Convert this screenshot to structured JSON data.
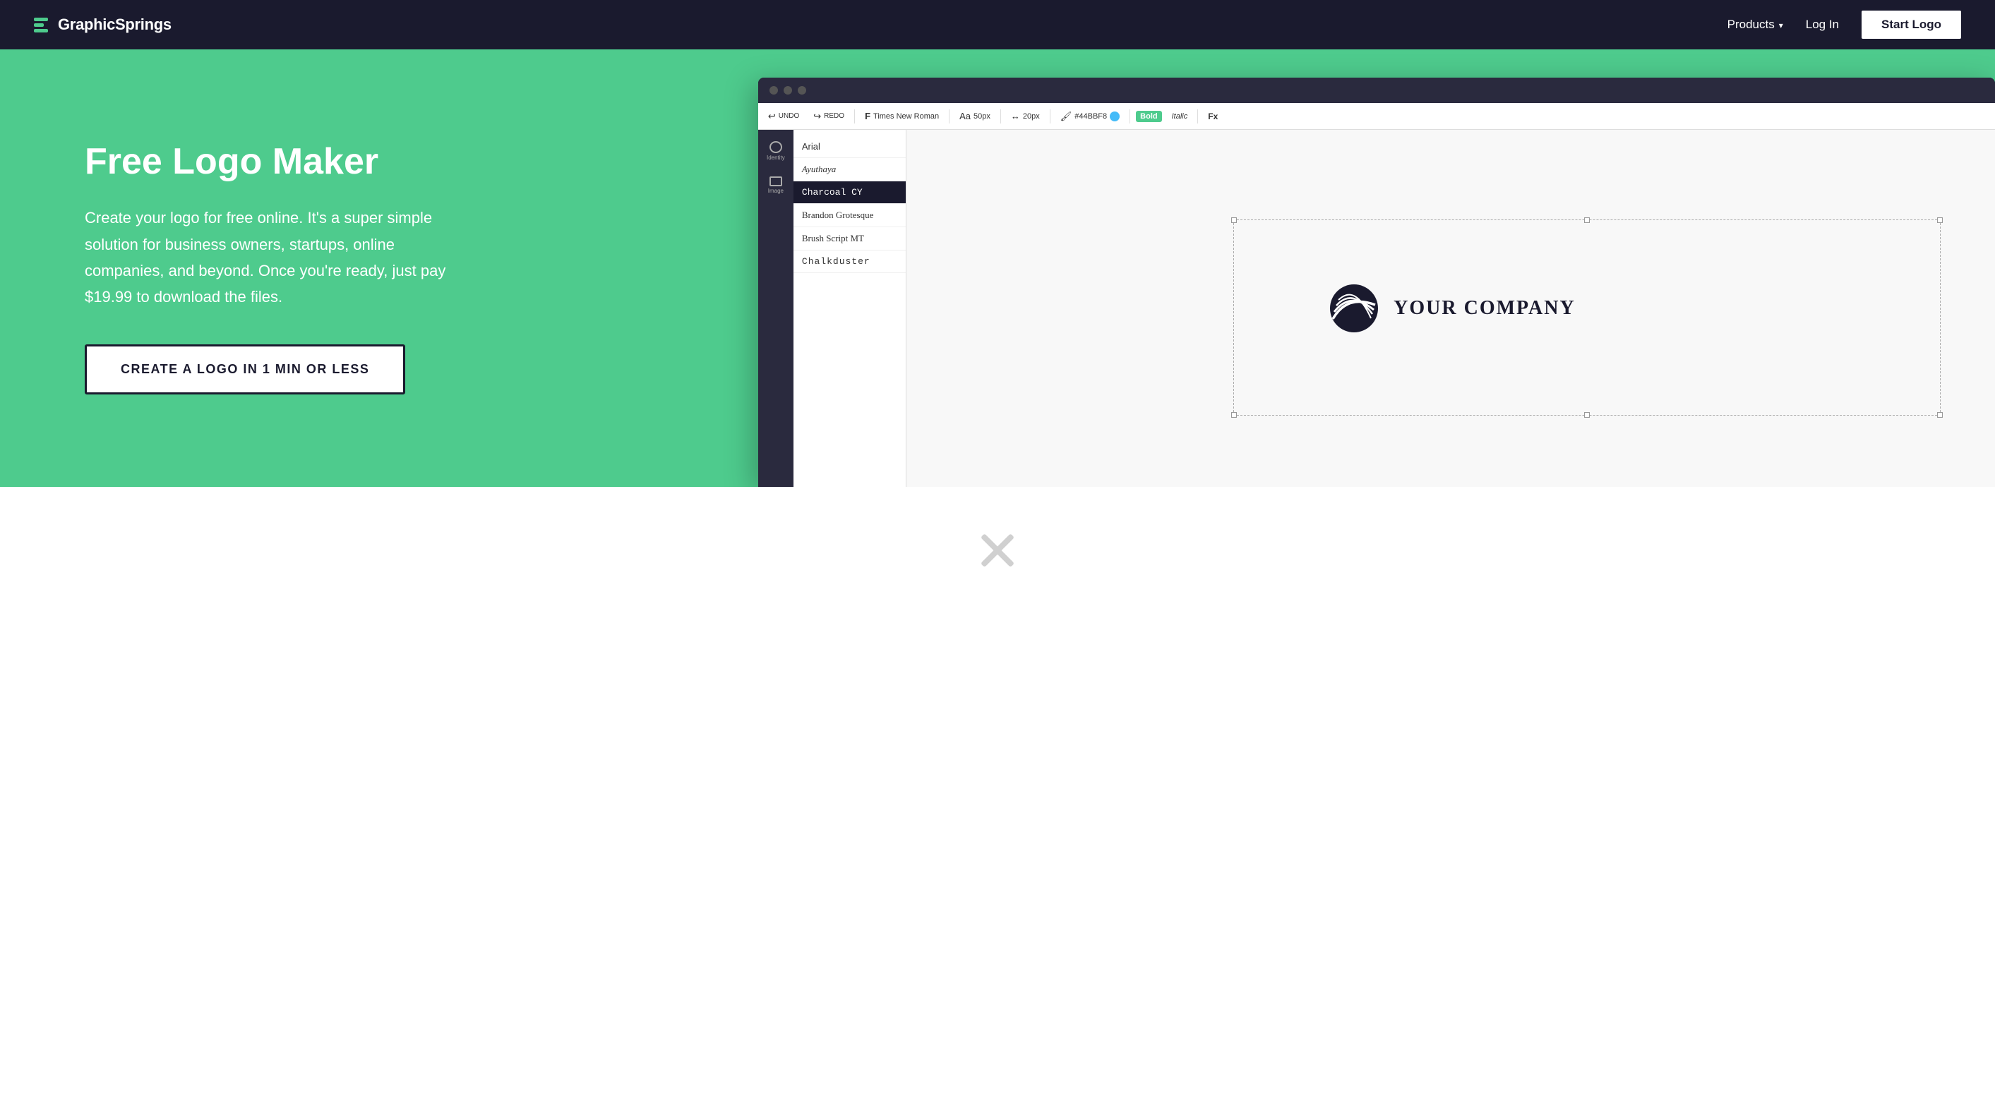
{
  "navbar": {
    "brand_name": "GraphicSprings",
    "products_label": "Products",
    "login_label": "Log In",
    "start_logo_label": "Start Logo"
  },
  "hero": {
    "title": "Free Logo Maker",
    "description": "Create your logo for free online. It's a super simple solution for business owners, startups, online companies, and beyond. Once you're ready, just pay $19.99 to download the files.",
    "cta_label": "CREATE A LOGO IN 1 MIN OR LESS"
  },
  "mockup": {
    "toolbar": {
      "font_label": "Times New Roman",
      "size_label": "50px",
      "spacing_label": "20px",
      "color_hex": "#44BBF8",
      "style_bold": "Bold",
      "style_italic": "Italic",
      "fx_label": "Fx"
    },
    "font_panel": {
      "fonts": [
        {
          "name": "Arial",
          "selected": false
        },
        {
          "name": "Ayuthaya",
          "selected": false
        },
        {
          "name": "Charcoal CY",
          "selected": true
        },
        {
          "name": "Brandon Grotesque",
          "selected": false
        },
        {
          "name": "Brush Script MT",
          "selected": false
        },
        {
          "name": "Chalkduster",
          "selected": false
        }
      ]
    },
    "canvas": {
      "company_text": "YOUR COMPANY"
    }
  },
  "lower_section": {
    "tools_icon_label": "tools-cross-icon"
  },
  "colors": {
    "navbar_bg": "#1a1a2e",
    "hero_bg": "#4ecb8d",
    "brand_accent": "#4ecb8d",
    "white": "#ffffff",
    "dark": "#1a1a2e"
  }
}
